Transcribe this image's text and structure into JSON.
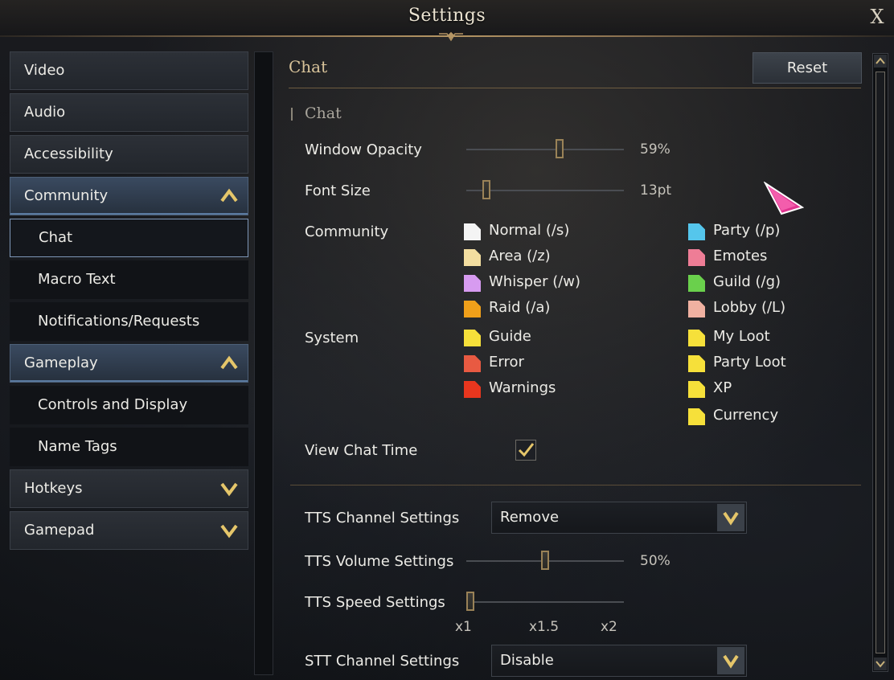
{
  "window": {
    "title": "Settings",
    "close_label": "X"
  },
  "sidebar": {
    "items": [
      {
        "label": "Video"
      },
      {
        "label": "Audio"
      },
      {
        "label": "Accessibility"
      },
      {
        "label": "Community"
      },
      {
        "label": "Chat"
      },
      {
        "label": "Macro Text"
      },
      {
        "label": "Notifications/Requests"
      },
      {
        "label": "Gameplay"
      },
      {
        "label": "Controls and Display"
      },
      {
        "label": "Name Tags"
      },
      {
        "label": "Hotkeys"
      },
      {
        "label": "Gamepad"
      }
    ],
    "selected": "Chat"
  },
  "content": {
    "section_title": "Chat",
    "reset_label": "Reset",
    "subsection": "Chat",
    "window_opacity": {
      "label": "Window Opacity",
      "value": "59%",
      "level": 0.59
    },
    "font_size": {
      "label": "Font Size",
      "value": "13pt",
      "level": 0.13
    },
    "community": {
      "label": "Community",
      "left": [
        {
          "label": "Normal (/s)",
          "color": "#f4f4f4"
        },
        {
          "label": "Area (/z)",
          "color": "#f3dea0"
        },
        {
          "label": "Whisper (/w)",
          "color": "#d79bf0"
        },
        {
          "label": "Raid (/a)",
          "color": "#f0a01a"
        }
      ],
      "right": [
        {
          "label": "Party (/p)",
          "color": "#55c6ec"
        },
        {
          "label": "Emotes",
          "color": "#ee7d96"
        },
        {
          "label": "Guild (/g)",
          "color": "#6ad04c"
        },
        {
          "label": "Lobby (/L)",
          "color": "#f0b1a1"
        }
      ]
    },
    "system": {
      "label": "System",
      "left": [
        {
          "label": "Guide",
          "color": "#f6e03a"
        },
        {
          "label": "Error",
          "color": "#e85a42"
        },
        {
          "label": "Warnings",
          "color": "#e8361e"
        }
      ],
      "right": [
        {
          "label": "My Loot",
          "color": "#f6e03a"
        },
        {
          "label": "Party Loot",
          "color": "#f6e03a"
        },
        {
          "label": "XP",
          "color": "#f6e03a"
        },
        {
          "label": "Currency",
          "color": "#f6e03a"
        }
      ]
    },
    "view_chat_time": {
      "label": "View Chat Time",
      "checked": true
    },
    "tts_channel": {
      "label": "TTS Channel Settings",
      "value": "Remove"
    },
    "tts_volume": {
      "label": "TTS Volume Settings",
      "value": "50%",
      "level": 0.5
    },
    "tts_speed": {
      "label": "TTS Speed Settings",
      "ticks": [
        "x1",
        "x1.5",
        "x2"
      ],
      "selected": "x1"
    },
    "stt_channel": {
      "label": "STT Channel Settings",
      "value": "Disable"
    }
  },
  "icons": {
    "close": "close-icon",
    "expanded": "chevron-up-icon",
    "collapsed": "chevron-down-icon",
    "dropdown": "chevron-down-icon",
    "check": "check-icon",
    "cursor": "pink-arrow-cursor"
  }
}
